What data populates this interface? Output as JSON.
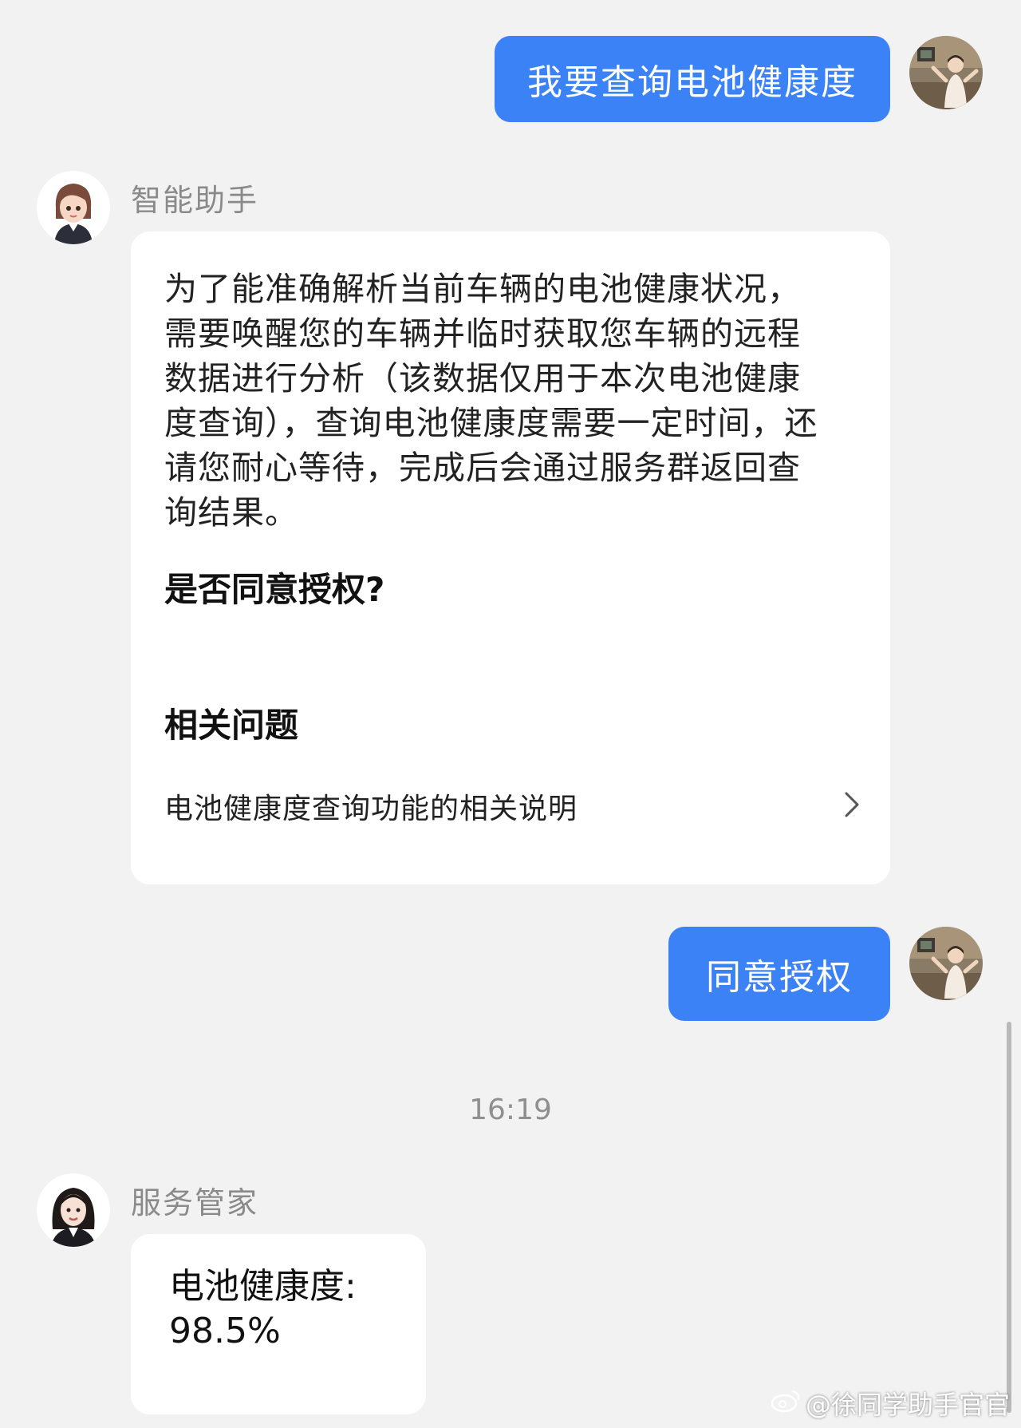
{
  "messages": {
    "user_query": "我要查询电池健康度",
    "assistant_name": "智能助手",
    "assistant_body": "为了能准确解析当前车辆的电池健康状况，需要唤醒您的车辆并临时获取您车辆的远程数据进行分析（该数据仅用于本次电池健康度查询），查询电池健康度需要一定时间，还请您耐心等待，完成后会通过服务群返回查询结果。",
    "auth_question": "是否同意授权?",
    "related_title": "相关问题",
    "related_link": "电池健康度查询功能的相关说明",
    "user_reply": "同意授权",
    "timestamp": "16:19",
    "service_name": "服务管家",
    "result_label": "电池健康度:",
    "result_value": "98.5%"
  },
  "watermark": "@徐同学助手官官",
  "colors": {
    "user_bubble": "#3b82f6",
    "background": "#f2f2f2",
    "card": "#ffffff"
  },
  "icons": {
    "chevron": "chevron-right-icon",
    "weibo": "weibo-logo-icon"
  }
}
